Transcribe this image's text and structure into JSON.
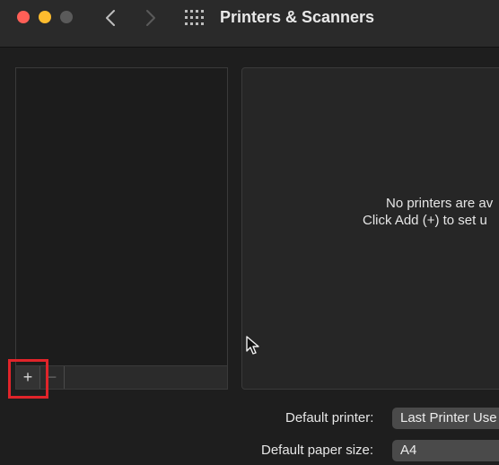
{
  "window": {
    "title": "Printers & Scanners"
  },
  "icons": {
    "back": "chevron-left-icon",
    "forward": "chevron-right-icon",
    "show_all": "grid-icon"
  },
  "printer_list": {
    "add_label": "+",
    "remove_label": "−"
  },
  "detail": {
    "empty_line1": "No printers are av",
    "empty_line2": "Click Add (+) to set u"
  },
  "settings": {
    "default_printer_label": "Default printer:",
    "default_printer_value": "Last Printer Use",
    "paper_size_label": "Default paper size:",
    "paper_size_value": "A4"
  },
  "colors": {
    "close": "#ff5f57",
    "minimize": "#febc2e",
    "zoom_disabled": "#5a5a5a",
    "highlight": "#e0242a"
  }
}
